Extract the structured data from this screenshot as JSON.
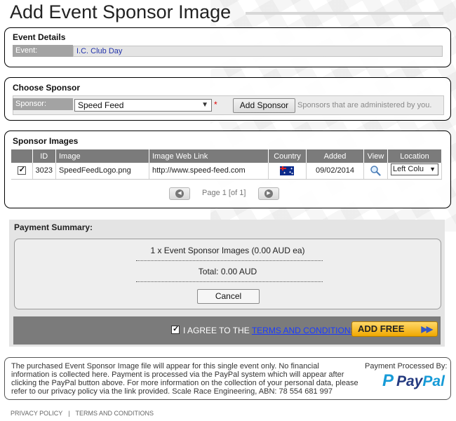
{
  "page": {
    "title": "Add Event Sponsor Image"
  },
  "event_details": {
    "heading": "Event Details",
    "event_label": "Event:",
    "event_value": "I.C. Club Day"
  },
  "choose_sponsor": {
    "heading": "Choose Sponsor",
    "sponsor_label": "Sponsor:",
    "sponsor_value": "Speed Feed",
    "required_mark": "*",
    "add_button": "Add Sponsor",
    "hint": "Sponsors that are administered by you."
  },
  "sponsor_images": {
    "heading": "Sponsor Images",
    "columns": [
      "ID",
      "Image",
      "Image Web Link",
      "Country",
      "Added",
      "View",
      "Location"
    ],
    "rows": [
      {
        "id": "3023",
        "image": "SpeedFeedLogo.png",
        "link": "http://www.speed-feed.com",
        "country_icon": "australia-flag",
        "added": "09/02/2014",
        "view_icon": "magnifier-icon",
        "location": "Left Colu"
      }
    ],
    "pager_text": "Page 1 [of 1]"
  },
  "payment": {
    "heading": "Payment Summary:",
    "line_item": "1 x Event Sponsor Images (0.00 AUD ea)",
    "total": "Total: 0.00 AUD",
    "cancel": "Cancel",
    "agree_prefix": "I AGREE TO THE ",
    "agree_link": "TERMS AND CONDITIONS",
    "add_free": "ADD FREE"
  },
  "notice": {
    "text": "The purchased Event Sponsor Image file will appear for this single event only. No financial information is collected here. Payment is processed via the PayPal system which will appear after clicking the PayPal button above. For more information on the collection of your personal data, please refer to our privacy policy via the link provided. Scale Race Engineering, ABN: 78 554 681 997",
    "processed_label": "Payment Processed By:",
    "paypal_part1": "Pay",
    "paypal_part2": "Pal",
    "paypal_mark": "P"
  },
  "footer": {
    "privacy": "PRIVACY POLICY",
    "separator": "|",
    "terms": "TERMS AND CONDITIONS"
  }
}
